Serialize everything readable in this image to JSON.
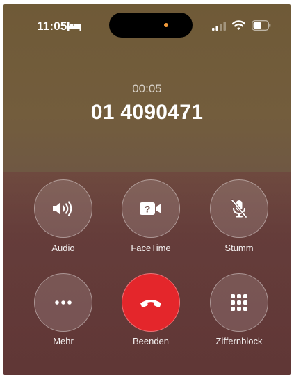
{
  "status_bar": {
    "time": "11:05",
    "icons": [
      "bed-icon",
      "signal-icon",
      "wifi-icon",
      "battery-icon"
    ]
  },
  "call": {
    "timer": "00:05",
    "number": "01 4090471"
  },
  "controls": {
    "audio_label": "Audio",
    "facetime_label": "FaceTime",
    "mute_label": "Stumm",
    "more_label": "Mehr",
    "end_label": "Beenden",
    "keypad_label": "Ziffernblock"
  },
  "colors": {
    "end_button": "#e4262b",
    "island_indicator": "#f29a3a"
  }
}
